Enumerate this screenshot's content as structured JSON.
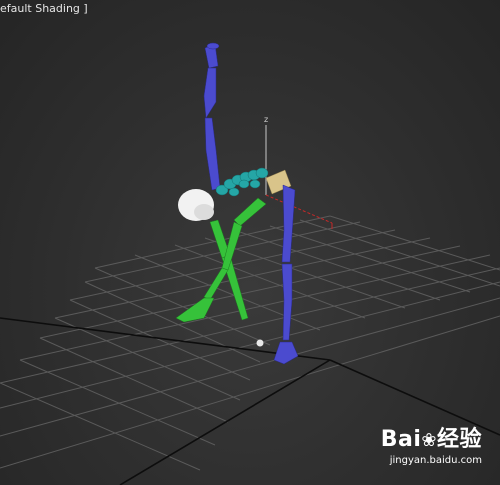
{
  "viewport": {
    "label": "efault Shading ]",
    "axis_label": "z"
  },
  "watermark": {
    "logo_text": "Bai",
    "logo_icon": "paw-icon",
    "logo_cn": "经验",
    "site": "jingyan.baidu.com"
  },
  "colors": {
    "background": "#2e2e2e",
    "grid": "#5a5a5a",
    "grid_axis": "#0a0a0a",
    "biped_leg_right": "#4b4bcf",
    "biped_leg_left": "#36c23a",
    "biped_spine": "#25a6a6",
    "biped_pelvis": "#d9c48a",
    "biped_head": "#f2f2f2"
  }
}
